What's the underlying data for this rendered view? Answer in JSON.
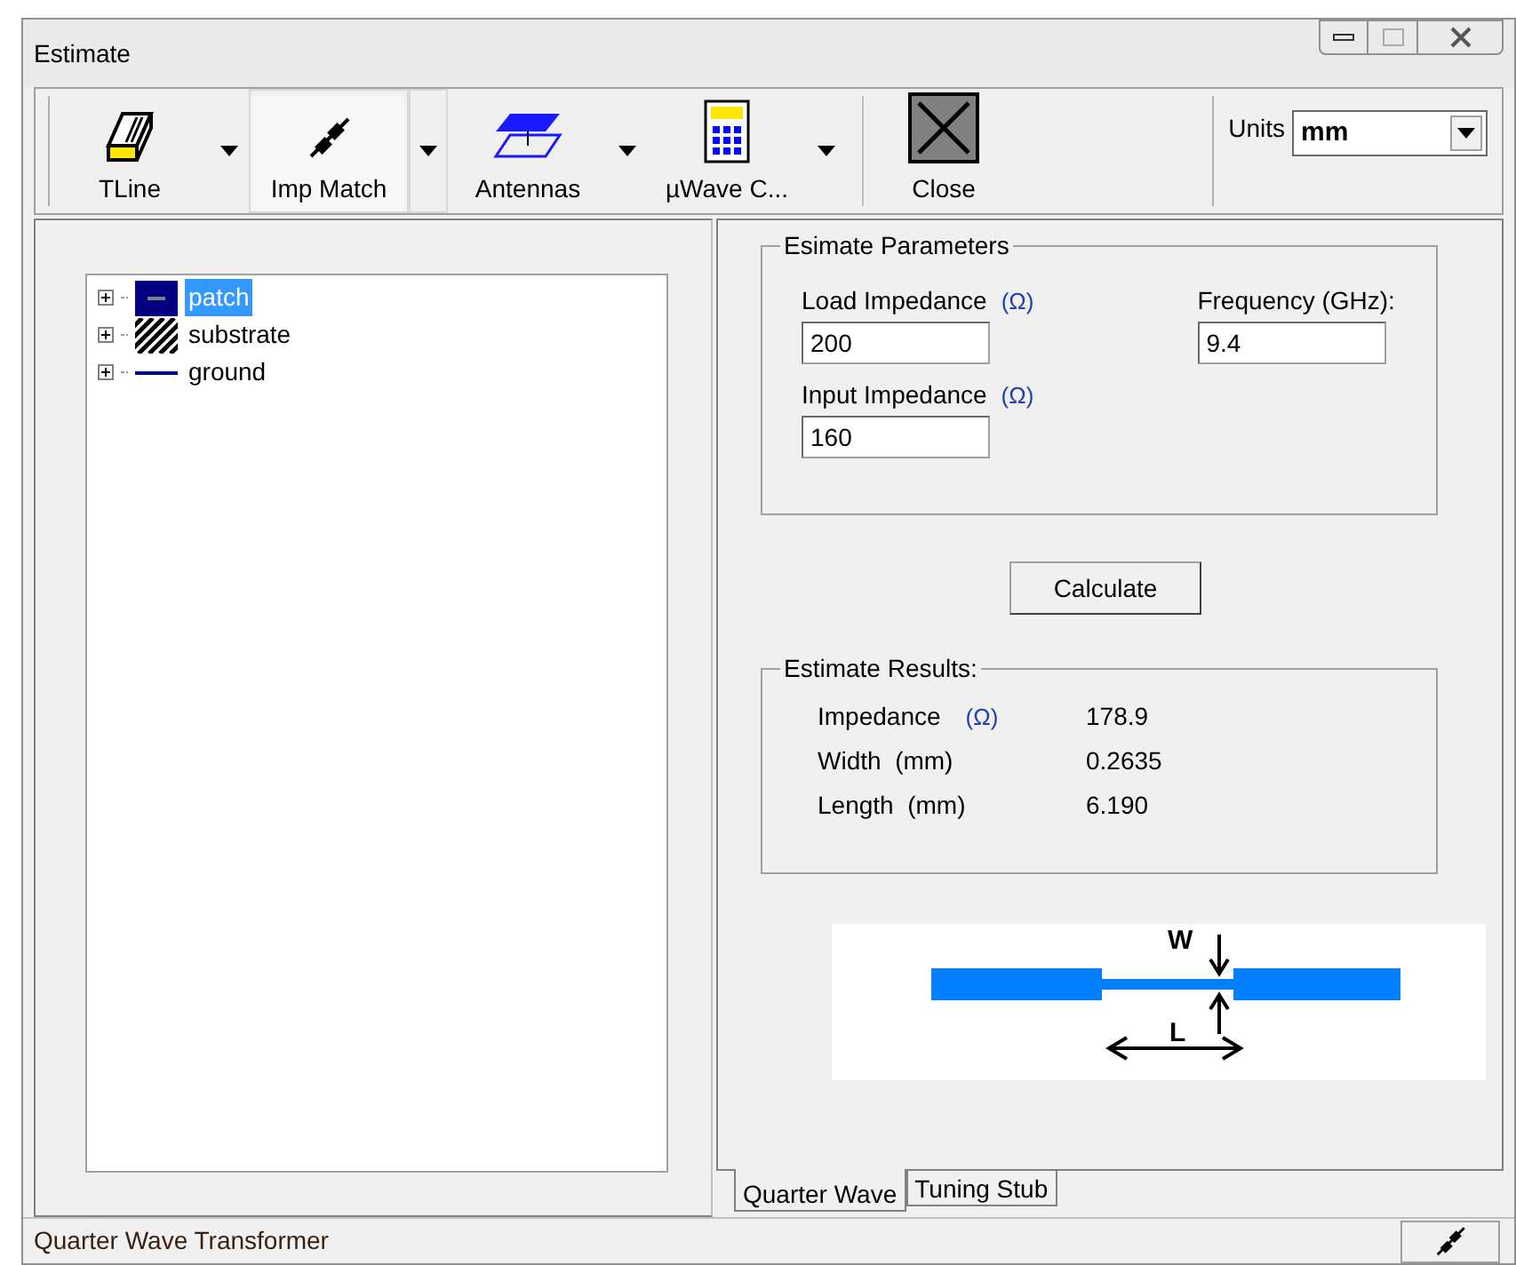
{
  "window": {
    "title": "Estimate"
  },
  "toolbar": {
    "buttons": [
      {
        "label": "TLine",
        "kind": "tline",
        "dropdown": true,
        "selected": false
      },
      {
        "label": "Imp Match",
        "kind": "match",
        "dropdown": true,
        "selected": true
      },
      {
        "label": "Antennas",
        "kind": "antenna",
        "dropdown": true,
        "selected": false
      },
      {
        "label": "µWave C...",
        "kind": "calc",
        "dropdown": true,
        "selected": false
      },
      {
        "label": "Close",
        "kind": "close",
        "dropdown": false,
        "selected": false
      }
    ],
    "units": {
      "label": "Units",
      "value": "mm"
    }
  },
  "tree": {
    "items": [
      {
        "label": "patch",
        "kind": "patch",
        "expanded": false,
        "selected": true
      },
      {
        "label": "substrate",
        "kind": "substrate",
        "expanded": false,
        "selected": false
      },
      {
        "label": "ground",
        "kind": "ground",
        "expanded": false,
        "selected": false
      }
    ]
  },
  "parameters": {
    "title": "Esimate Parameters",
    "load_impedance": {
      "label": "Load Impedance",
      "unit": "(Ω)",
      "value": "200"
    },
    "frequency": {
      "label": "Frequency (GHz):",
      "value": "9.4"
    },
    "input_impedance": {
      "label": "Input Impedance",
      "unit": "(Ω)",
      "value": "160"
    }
  },
  "calculate_button": "Calculate",
  "results": {
    "title": "Estimate Results:",
    "rows": [
      {
        "label": "Impedance",
        "unit": "(Ω)",
        "value": "178.9"
      },
      {
        "label": "Width  (mm)",
        "value": "0.2635"
      },
      {
        "label": "Length  (mm)",
        "value": "6.190"
      }
    ]
  },
  "diagram": {
    "w_label": "W",
    "l_label": "L"
  },
  "tabs": [
    {
      "label": "Quarter Wave",
      "selected": true
    },
    {
      "label": "Tuning Stub",
      "selected": false
    }
  ],
  "status_bar": {
    "text": "Quarter Wave Transformer"
  }
}
